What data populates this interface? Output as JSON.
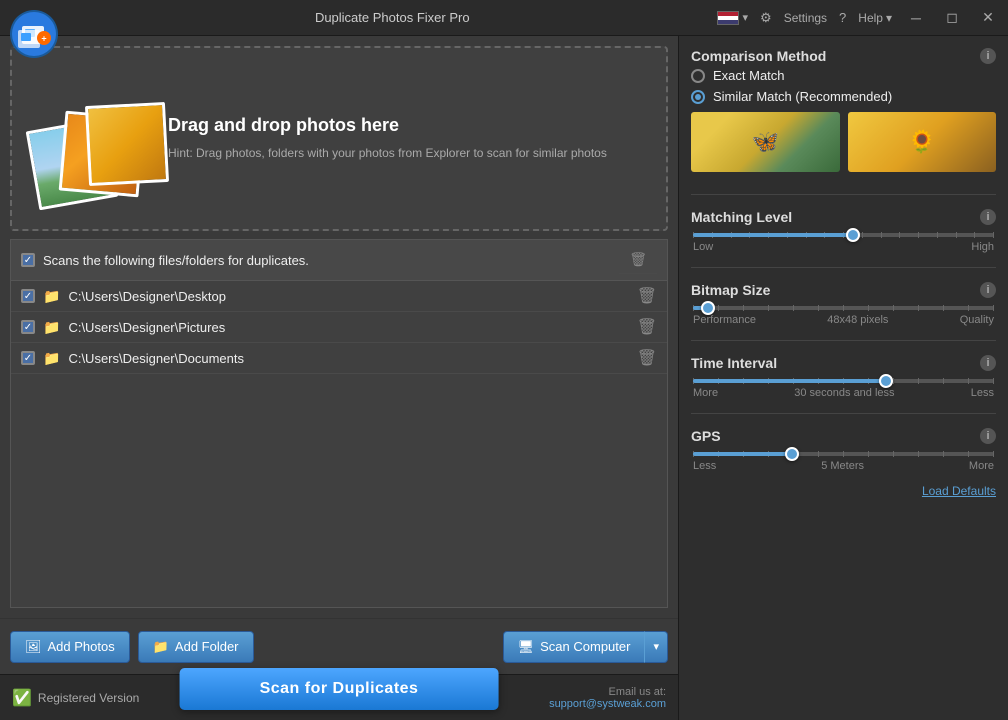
{
  "window": {
    "title": "Duplicate Photos Fixer Pro",
    "settings_label": "Settings",
    "help_label": "Help"
  },
  "drop_zone": {
    "heading": "Drag and drop photos here",
    "hint": "Hint: Drag photos, folders with your photos from Explorer to scan for similar photos"
  },
  "file_list": {
    "header": "Scans the following files/folders for duplicates.",
    "items": [
      {
        "path": "C:\\Users\\Designer\\Desktop"
      },
      {
        "path": "C:\\Users\\Designer\\Pictures"
      },
      {
        "path": "C:\\Users\\Designer\\Documents"
      }
    ]
  },
  "buttons": {
    "add_photos": "Add Photos",
    "add_folder": "Add Folder",
    "scan_computer": "Scan Computer",
    "scan_duplicates": "Scan for Duplicates",
    "load_defaults": "Load Defaults"
  },
  "status": {
    "registered": "Registered Version"
  },
  "email": {
    "label": "Email us at:",
    "address": "support@systweak.com"
  },
  "right_panel": {
    "comparison_method": {
      "title": "Comparison Method",
      "exact_match": "Exact Match",
      "similar_match": "Similar Match (Recommended)"
    },
    "matching_level": {
      "title": "Matching Level",
      "low": "Low",
      "high": "High",
      "thumb_pct": 53
    },
    "bitmap_size": {
      "title": "Bitmap Size",
      "performance": "Performance",
      "quality": "Quality",
      "value": "48x48 pixels",
      "thumb_pct": 5
    },
    "time_interval": {
      "title": "Time Interval",
      "more": "More",
      "less": "Less",
      "value": "30 seconds and less",
      "thumb_pct": 64
    },
    "gps": {
      "title": "GPS",
      "less": "Less",
      "more": "More",
      "value": "5 Meters",
      "thumb_pct": 33
    }
  }
}
